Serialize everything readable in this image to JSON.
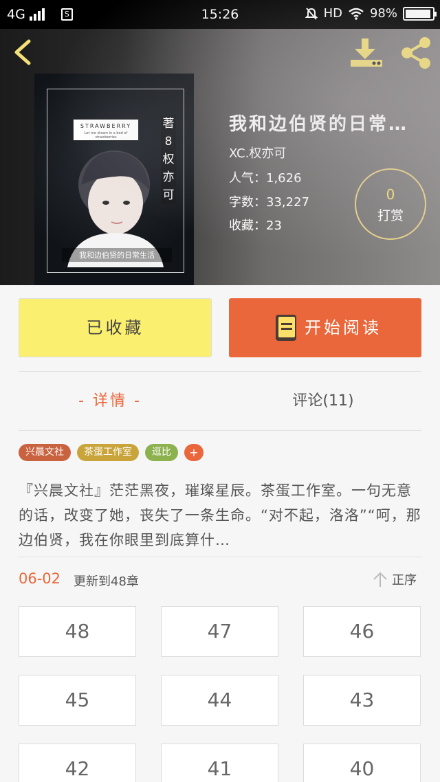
{
  "status_bar": {
    "network": "4G",
    "time": "15:26",
    "hd": "HD",
    "battery": "98%"
  },
  "book": {
    "title": "我和边伯贤的日常…",
    "author": "XC.权亦可",
    "popularity": "人气：1,626",
    "word_count": "字数：33,227",
    "favorites": "收藏：23",
    "tip_count": "0",
    "tip_label": "打赏"
  },
  "cover": {
    "label": "STRAWBERRY",
    "label_sub": "Let me drown in a bed of strawberries",
    "side_text": [
      "著",
      "8",
      "权",
      "亦",
      "可"
    ],
    "bottom_text": "我和边伯贤的日常生活"
  },
  "actions": {
    "favorited_label": "已收藏",
    "read_label": "开始阅读"
  },
  "tabs": {
    "detail": "- 详情 -",
    "comments": "评论(11)"
  },
  "tags": [
    {
      "label": "兴晨文社",
      "color": "#c9623f"
    },
    {
      "label": "茶蛋工作室",
      "color": "#c9a43a"
    },
    {
      "label": "逗比",
      "color": "#8cb14e"
    }
  ],
  "tag_add": "+",
  "intro": "『兴晨文社』茫茫黑夜，璀璨星辰。茶蛋工作室。一句无意的话，改变了她，丧失了一条生命。“对不起，洛洛”“呵，那边伯贤，我在你眼里到底算什…",
  "update": {
    "date": "06-02",
    "text": "更新到48章",
    "sort_label": "正序"
  },
  "chapters": [
    "48",
    "47",
    "46",
    "45",
    "44",
    "43",
    "42",
    "41",
    "40"
  ],
  "colors": {
    "accent": "#e9673b",
    "fav_button": "#fbef6f",
    "tip_ring": "#e8d28a"
  }
}
